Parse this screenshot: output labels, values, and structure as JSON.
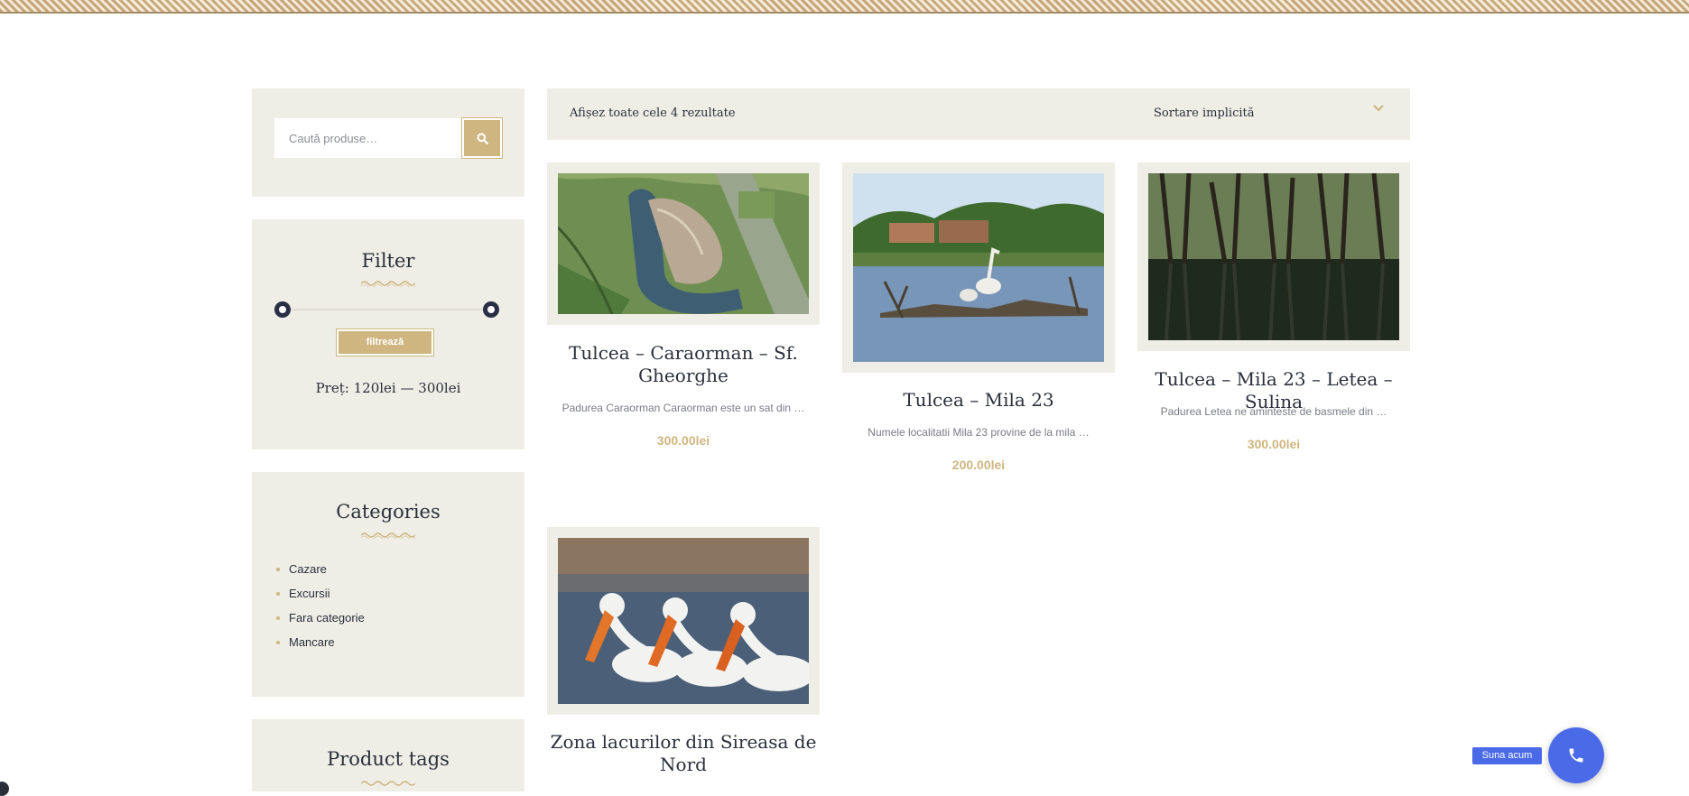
{
  "search": {
    "placeholder": "Caută produse…",
    "button_icon": "search-icon"
  },
  "filter": {
    "title": "Filter",
    "button_label": "filtrează",
    "price_label": "Preț:",
    "price_min": "120lei",
    "price_separator": "—",
    "price_max": "300lei"
  },
  "categories": {
    "title": "Categories",
    "items": [
      "Cazare",
      "Excursii",
      "Fara categorie",
      "Mancare"
    ]
  },
  "tags": {
    "title": "Product tags"
  },
  "toolbar": {
    "result_count": "Afișez toate cele 4 rezultate",
    "sort_selected": "Sortare implicită"
  },
  "products": [
    {
      "title": "Tulcea – Caraorman – Sf. Gheorghe",
      "excerpt": "Padurea Caraorman Caraorman este un sat din …",
      "price": "300.00lei"
    },
    {
      "title": "Tulcea – Mila 23",
      "excerpt": "Numele localitatii Mila 23 provine de la mila …",
      "price": "200.00lei"
    },
    {
      "title": "Tulcea – Mila 23 – Letea – Sulina",
      "excerpt": "Padurea Letea ne aminteste de basmele din …",
      "price": "300.00lei"
    },
    {
      "title": "Zona lacurilor din Sireasa de Nord",
      "excerpt": "",
      "price": ""
    }
  ],
  "call": {
    "label": "Suna acum",
    "icon": "phone-icon"
  },
  "colors": {
    "accent": "#cfb57f",
    "panel": "#efeee6",
    "call": "#4b6ae8",
    "text": "#2a2f3a"
  }
}
